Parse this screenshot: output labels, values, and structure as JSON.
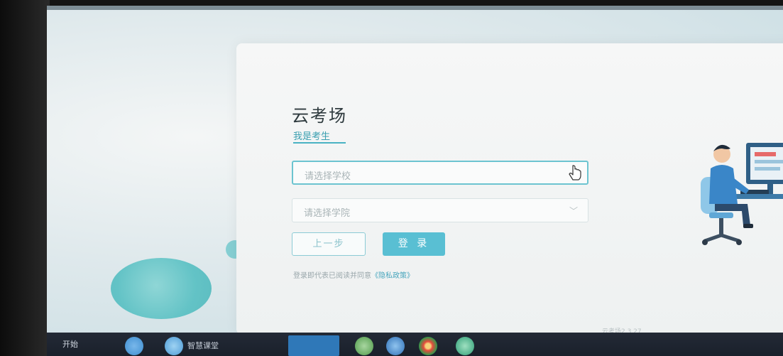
{
  "app": {
    "title": "云考场",
    "role_tab": "我是考生",
    "version": "云考场2.3.27"
  },
  "form": {
    "school_placeholder": "请选择学校",
    "college_placeholder": "请选择学院",
    "chevron": "﹀"
  },
  "buttons": {
    "prev": "上一步",
    "login": "登 录"
  },
  "policy": {
    "text": "登录即代表已阅读并同意",
    "link": "《隐私政策》"
  },
  "taskbar": {
    "start": "开始",
    "app_label": "智慧课堂"
  },
  "colors": {
    "accent": "#59bfd3",
    "tab_active": "#3a9fb0",
    "field_focus": "#6cc4d0"
  }
}
